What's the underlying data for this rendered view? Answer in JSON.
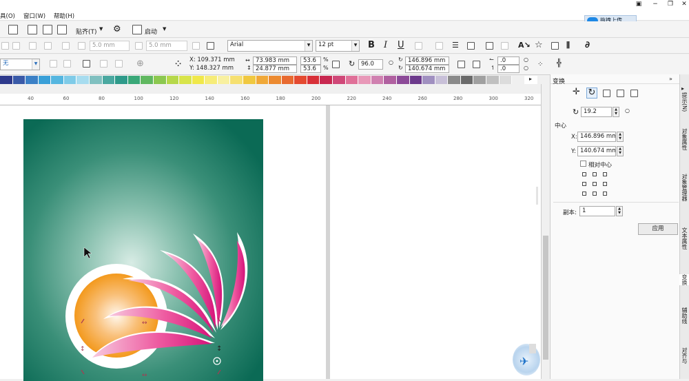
{
  "menubar": {
    "items": [
      "具(O)",
      "窗口(W)",
      "帮助(H)"
    ],
    "upload_label": "拖拽上传"
  },
  "toolbar1": {
    "snap_label": "贴齐(T)",
    "launch_label": "启动"
  },
  "toolbar2": {
    "field1": "5.0 mm",
    "field2": "5.0 mm",
    "font_name": "Arial",
    "font_size": "12 pt",
    "bold": "B",
    "italic": "I",
    "underline": "U"
  },
  "toolbar3": {
    "fill_value": "无",
    "x": "X: 109.371 mm",
    "y": "Y: 148.327 mm",
    "width": "73.983 mm",
    "height": "24.877 mm",
    "scale_x": "53.6",
    "scale_y": "53.6",
    "percent": "%",
    "rotation": "96.0",
    "center_x": "146.896 mm",
    "center_y": "140.674 mm",
    "skew_x": ".0",
    "skew_y": ".0"
  },
  "palette": [
    "#2e3a8c",
    "#3a5aa8",
    "#3b80c6",
    "#3aa0d8",
    "#55b6e0",
    "#7fcbe8",
    "#a7dcef",
    "#80c0c0",
    "#4aa8a0",
    "#2e9a8a",
    "#3aa878",
    "#60b860",
    "#8cc850",
    "#b6d84a",
    "#d8e44a",
    "#f0e84a",
    "#f6ec78",
    "#f8f0a0",
    "#f6e070",
    "#f0c840",
    "#f0a838",
    "#ec8a30",
    "#e86a30",
    "#e44a30",
    "#d83038",
    "#c82850",
    "#d04878",
    "#e07098",
    "#e898b8",
    "#d080b0",
    "#b060a0",
    "#8c4a98",
    "#6c3a8c",
    "#a090c0",
    "#c8c0d8",
    "#8a8a8a",
    "#6a6a6a",
    "#a0a0a0",
    "#c0c0c0",
    "#dcdcdc",
    "#f0f0f0",
    "#ffffff"
  ],
  "ruler": {
    "ticks": [
      "40",
      "60",
      "80",
      "100",
      "120",
      "140",
      "160",
      "180",
      "200",
      "220",
      "240",
      "260",
      "280",
      "300",
      "320"
    ]
  },
  "panel": {
    "title": "变换",
    "angle": "19.2",
    "center_label": "中心",
    "x_label": "X:",
    "x_value": "146.896 mm",
    "y_label": "Y:",
    "y_value": "140.674 mm",
    "relative_center": "相对中心",
    "copies_label": "副本:",
    "copies_value": "1",
    "apply_label": "应用"
  },
  "side_tabs": [
    "提示(N)",
    "对象属性",
    "对象管理器",
    "文本属性",
    "变换",
    "辅助线",
    "对齐与"
  ]
}
